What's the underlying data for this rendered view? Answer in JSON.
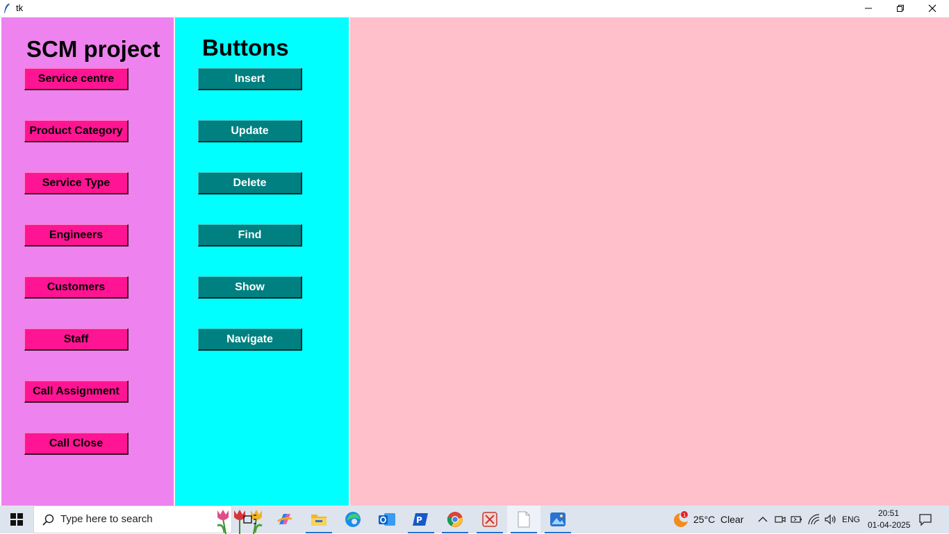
{
  "window": {
    "title": "tk"
  },
  "left_panel": {
    "heading": "SCM project",
    "buttons": [
      "Service centre",
      "Product Category",
      "Service Type",
      "Engineers",
      "Customers",
      "Staff",
      "Call Assignment",
      "Call Close"
    ]
  },
  "mid_panel": {
    "heading": "Buttons",
    "buttons": [
      "Insert",
      "Update",
      "Delete",
      "Find",
      "Show",
      "Navigate"
    ]
  },
  "colors": {
    "left_panel_bg": "#ee82ee",
    "mid_panel_bg": "#00ffff",
    "right_panel_bg": "#ffc0cb",
    "entity_button_bg": "#ff1493",
    "action_button_bg": "#008080"
  },
  "taskbar": {
    "search_placeholder": "Type here to search",
    "apps": [
      "task-view-icon",
      "copilot-icon",
      "file-explorer-icon",
      "edge-icon",
      "outlook-icon",
      "pycharm-icon",
      "chrome-icon",
      "snipping-tool-icon",
      "notepad-icon",
      "photos-icon"
    ],
    "weather": {
      "temp": "25°C",
      "condition": "Clear",
      "badge": "1"
    },
    "language": "ENG",
    "time": "20:51",
    "date": "01-04-2025"
  }
}
